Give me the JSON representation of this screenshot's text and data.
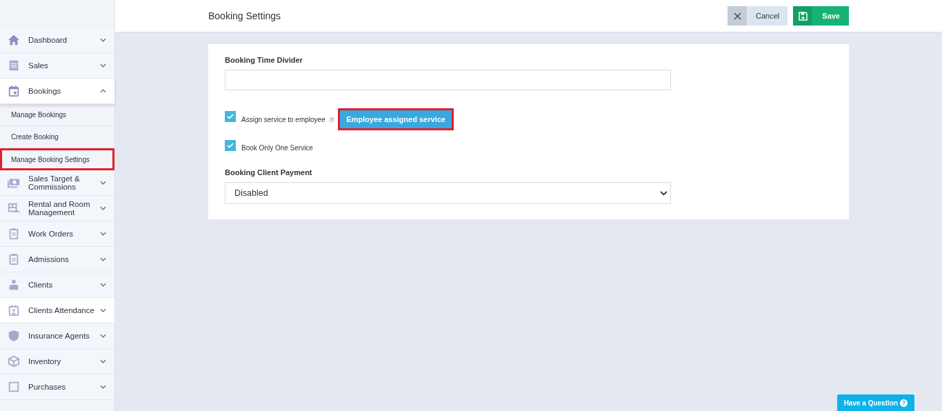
{
  "header": {
    "title": "Booking Settings",
    "buttons": [
      {
        "kind": "cancel",
        "label": "Cancel"
      },
      {
        "kind": "save",
        "label": "Save"
      }
    ]
  },
  "sidebar": {
    "items": [
      {
        "label": "Dashboard",
        "expanded": false,
        "hovered": false
      },
      {
        "label": "Sales",
        "expanded": false,
        "hovered": false
      },
      {
        "label": "Bookings",
        "expanded": true,
        "hovered": false,
        "children": [
          {
            "label": "Manage Bookings",
            "highlighted": false
          },
          {
            "label": "Create Booking",
            "highlighted": false
          },
          {
            "label": "Manage Booking Settings",
            "highlighted": true
          }
        ]
      },
      {
        "label": "Sales Target & Commissions",
        "expanded": false,
        "hovered": false
      },
      {
        "label": "Rental and Room Management",
        "expanded": false,
        "hovered": false
      },
      {
        "label": "Work Orders",
        "expanded": false,
        "hovered": false
      },
      {
        "label": "Admissions",
        "expanded": false,
        "hovered": false
      },
      {
        "label": "Clients",
        "expanded": false,
        "hovered": false
      },
      {
        "label": "Clients Attendance",
        "expanded": false,
        "hovered": true
      },
      {
        "label": "Insurance Agents",
        "expanded": false,
        "hovered": false
      },
      {
        "label": "Inventory",
        "expanded": false,
        "hovered": false
      },
      {
        "label": "Purchases",
        "expanded": false,
        "hovered": false
      }
    ]
  },
  "form": {
    "fields": [
      {
        "kind": "text",
        "label": "Booking Time Divider"
      },
      {
        "kind": "checkbox",
        "label": "Assign service to employee",
        "checked": true,
        "help": "?",
        "button": {
          "label": "Employee assigned service",
          "highlighted": true
        }
      },
      {
        "kind": "checkbox",
        "label": "Book Only One Service",
        "checked": true
      },
      {
        "kind": "select",
        "label": "Booking Client Payment",
        "value": "Disabled"
      }
    ]
  },
  "help_button": {
    "label": "Have a Question",
    "icon": "?"
  }
}
